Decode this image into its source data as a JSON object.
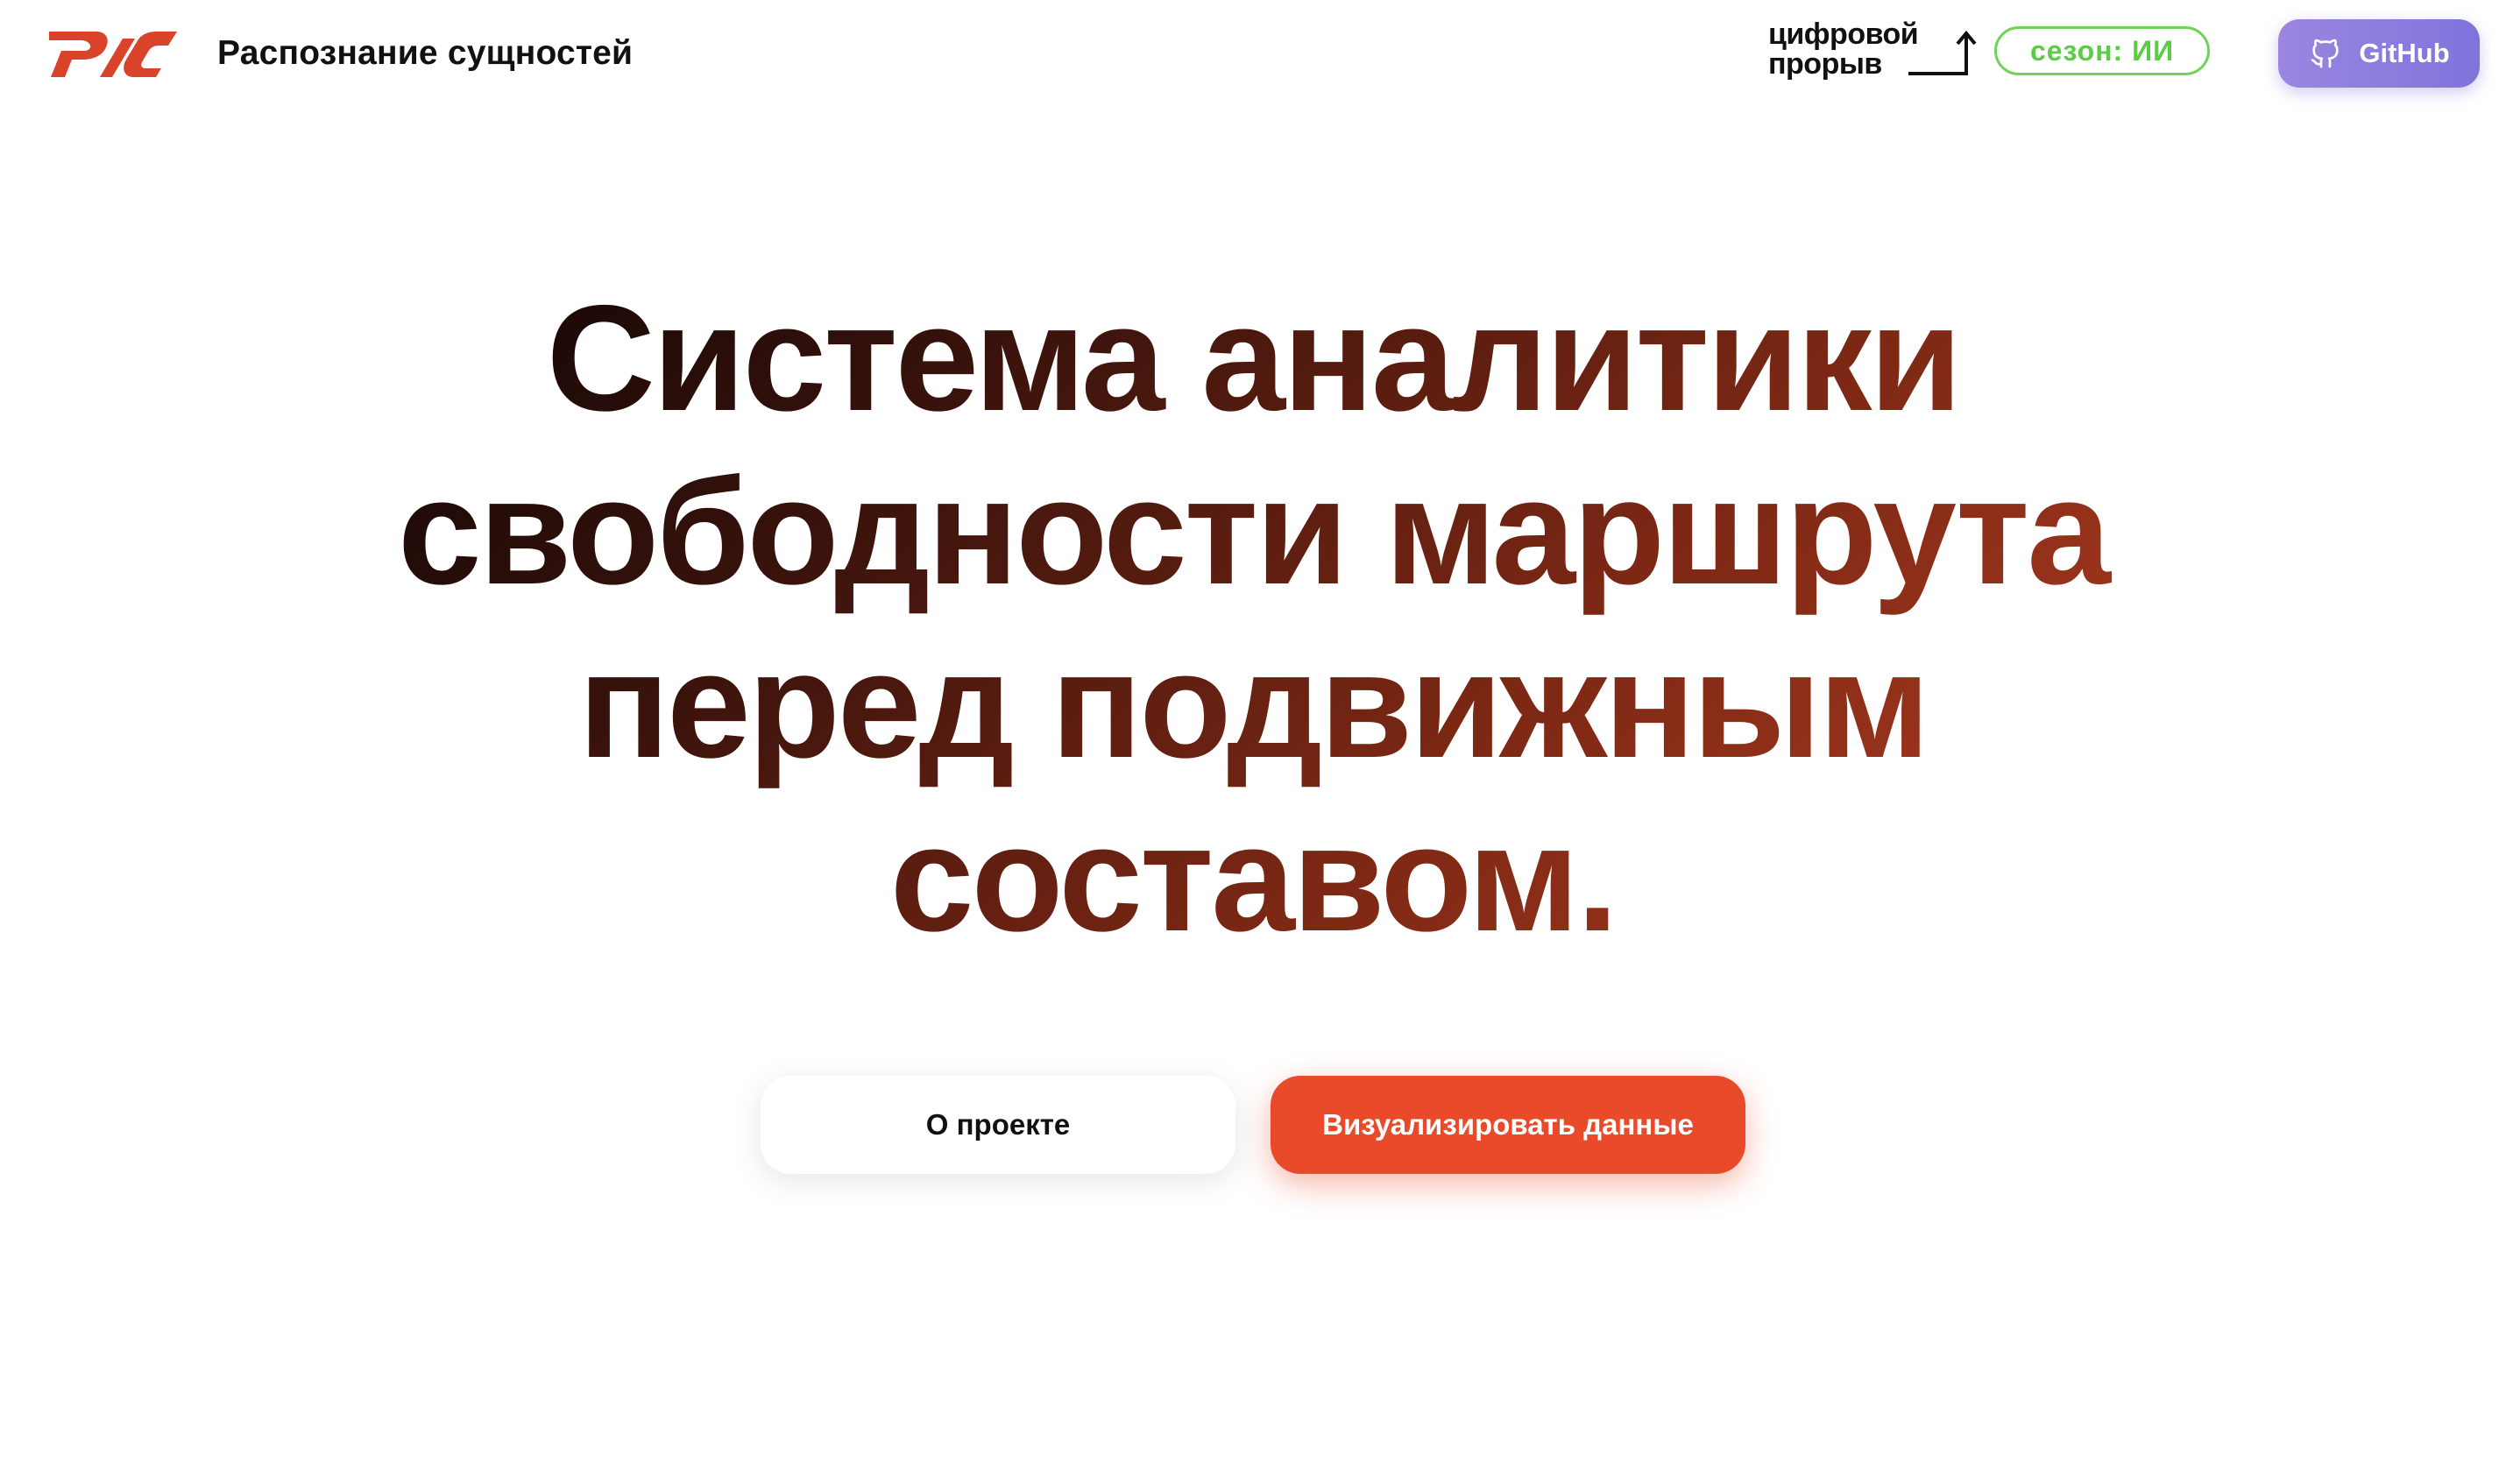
{
  "header": {
    "brand_logo_icon": "rzd-logo",
    "brand_title": "Распознание сущностей",
    "event_logo": {
      "line1": "цифровой",
      "line2": "прорыв",
      "icon": "arrow-up-icon"
    },
    "season_badge": "сезон: ИИ",
    "github": {
      "label": "GitHub",
      "icon": "github-icon"
    }
  },
  "hero": {
    "title_lines": [
      "Система аналитики",
      "свободности маршрута",
      "перед подвижным",
      "составом."
    ]
  },
  "actions": {
    "about_label": "О проекте",
    "visualize_label": "Визуализировать данные"
  },
  "colors": {
    "brand_red": "#e94a2a",
    "season_green": "#5ccb46",
    "github_purple": "#8a7ddf",
    "title_dark": "#0e0404",
    "title_rust": "#b33d22"
  }
}
